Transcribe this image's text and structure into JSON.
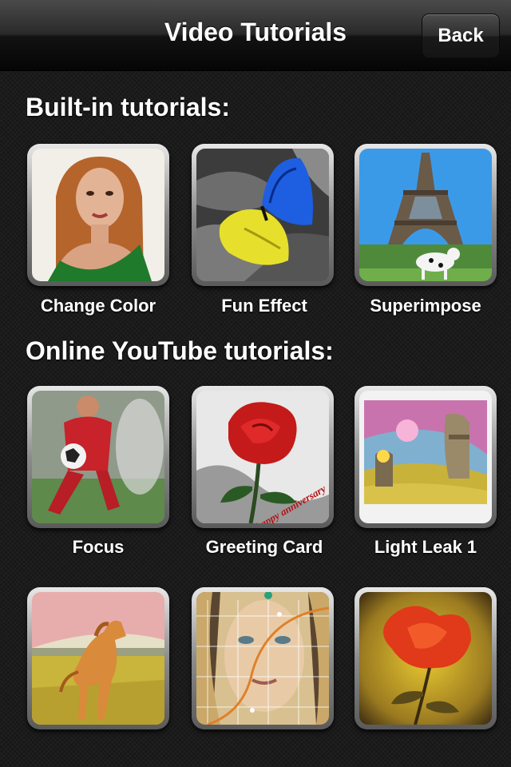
{
  "navbar": {
    "title": "Video Tutorials",
    "back_label": "Back"
  },
  "sections": {
    "builtin_heading": "Built-in tutorials:",
    "online_heading": "Online YouTube tutorials:"
  },
  "builtin": [
    {
      "label": "Change Color"
    },
    {
      "label": "Fun Effect"
    },
    {
      "label": "Superimpose"
    }
  ],
  "online": [
    {
      "label": "Focus"
    },
    {
      "label": "Greeting Card"
    },
    {
      "label": "Light Leak 1"
    },
    {
      "label": ""
    },
    {
      "label": ""
    },
    {
      "label": ""
    }
  ],
  "thumbnail_text": {
    "greeting_card_overlay": "happy anniversary"
  },
  "colors": {
    "navbar_text": "#ffffff",
    "background": "#1b1b1b"
  }
}
